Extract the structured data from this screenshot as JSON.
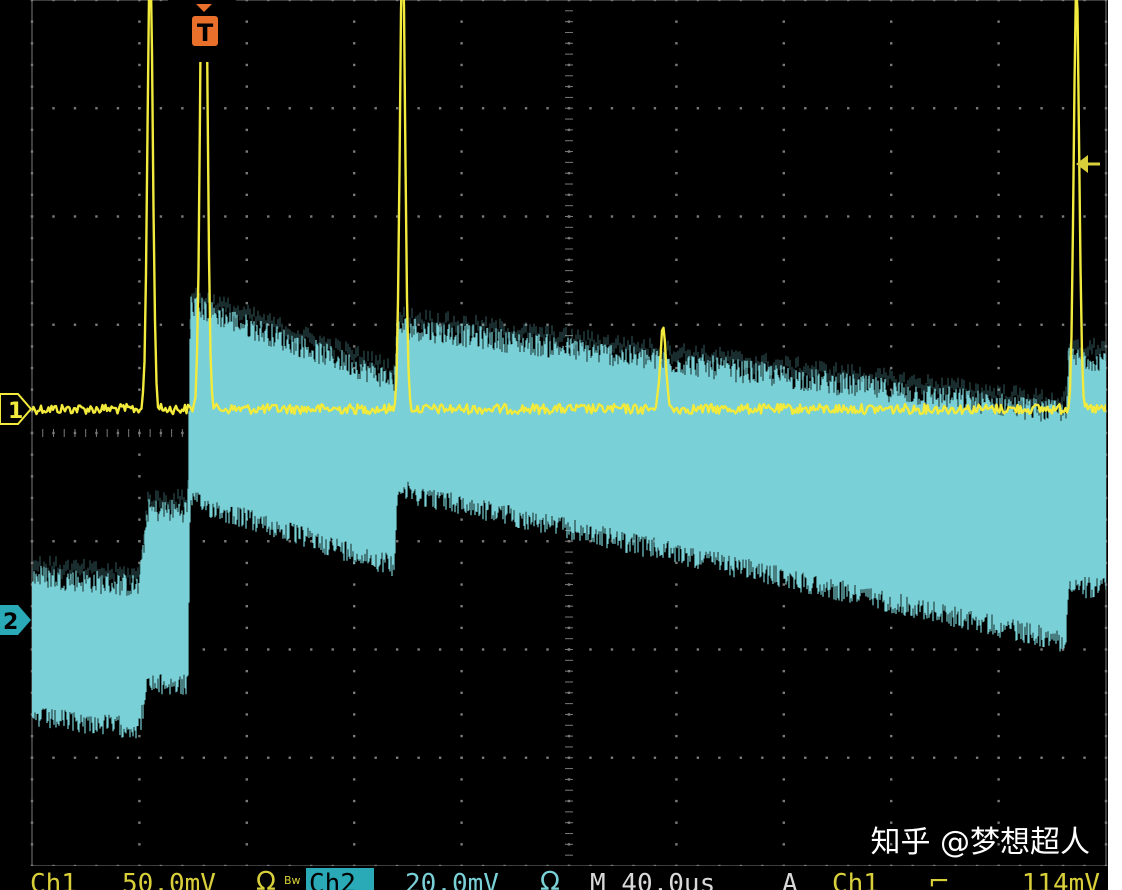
{
  "colors": {
    "screen": "#000000",
    "frame": "#ffffff",
    "grid": "#7a7a7a",
    "ch1": "#f2ea3c",
    "ch2": "#79d0d6",
    "trigger_marker": "#e8702a",
    "statusbar_bg": "#000000",
    "ch1_text": "#d8cf3a",
    "ch2_highlight": "#2aa9b6"
  },
  "markers": {
    "trigger": "T",
    "ch1": "1",
    "ch2": "2"
  },
  "statusbar": {
    "ch1_label": "Ch1",
    "ch1_scale": "50.0mV",
    "ch1_coupling": "Ω",
    "ch1_bw": "Bw",
    "ch2_label": "Ch2",
    "ch2_scale": "20.0mV",
    "ch2_coupling": "Ω",
    "timebase": "M 40.0us",
    "trigger_mode": "A",
    "trigger_source": "Ch1",
    "trigger_slope": "⌐",
    "trigger_level": "114mV"
  },
  "watermark": "知乎 @梦想超人",
  "chart_data": {
    "type": "line",
    "xlabel": "",
    "ylabel": "",
    "grid": true,
    "x_divisions": 10,
    "y_divisions": 8,
    "xlim_us": [
      0,
      400
    ],
    "series": [
      {
        "name": "Ch1",
        "scale": "50.0mV/div",
        "baseline_div": 0,
        "pulses_us_div": [
          [
            44,
            4.2
          ],
          [
            64,
            6.1
          ],
          [
            138,
            4.3
          ],
          [
            235,
            0.8
          ],
          [
            389,
            4.0
          ]
        ]
      },
      {
        "name": "Ch2",
        "scale": "20.0mV/div",
        "envelope_us_div": [
          [
            0,
            -0.8,
            0.3
          ],
          [
            40,
            -0.9,
            0.2
          ],
          [
            43,
            -0.5,
            0.9
          ],
          [
            58,
            -0.5,
            0.9
          ],
          [
            59,
            1.2,
            2.8
          ],
          [
            135,
            0.6,
            2.1
          ],
          [
            136,
            1.3,
            2.6
          ],
          [
            385,
            -0.1,
            1.8
          ],
          [
            386,
            0.4,
            2.3
          ],
          [
            400,
            0.4,
            2.3
          ]
        ]
      }
    ]
  }
}
